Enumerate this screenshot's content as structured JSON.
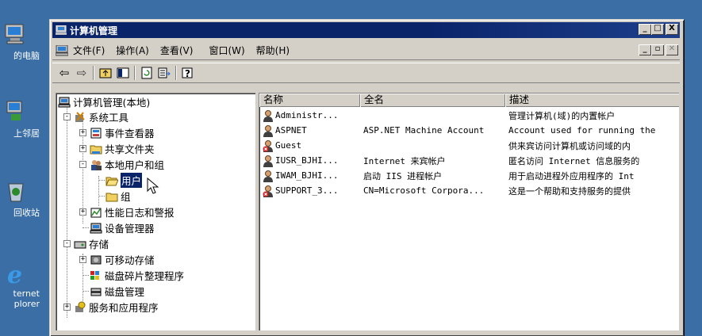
{
  "desktop": {
    "icons": [
      {
        "label": "的电脑",
        "icon": "my-computer-icon"
      },
      {
        "label": "上邻居",
        "icon": "network-places-icon"
      },
      {
        "label": "回收站",
        "icon": "recycle-bin-icon"
      },
      {
        "label": "ternet",
        "label2": "plorer",
        "icon": "internet-explorer-icon"
      }
    ]
  },
  "window": {
    "title": "计算机管理",
    "buttons": {
      "minimize": "_",
      "maximize": "□",
      "close": "X"
    }
  },
  "menubar": {
    "items": [
      "文件(F)",
      "操作(A)",
      "查看(V)",
      "窗口(W)",
      "帮助(H)"
    ],
    "child_buttons": {
      "minimize": "_",
      "restore": "▫",
      "close": "✕"
    }
  },
  "toolbar": {
    "back": "⇦",
    "forward": "⇨"
  },
  "tree": {
    "root": "计算机管理(本地)",
    "system_tools": "系统工具",
    "event_viewer": "事件查看器",
    "shared_folders": "共享文件夹",
    "local_users_groups": "本地用户和组",
    "users": "用户",
    "groups": "组",
    "perf_logs": "性能日志和警报",
    "device_manager": "设备管理器",
    "storage": "存储",
    "removable_storage": "可移动存储",
    "defrag": "磁盘碎片整理程序",
    "disk_mgmt": "磁盘管理",
    "services_apps": "服务和应用程序"
  },
  "list": {
    "headers": [
      "名称",
      "全名",
      "描述"
    ],
    "rows": [
      {
        "name": "Administr...",
        "full_name": "",
        "desc": "管理计算机(域)的内置帐户",
        "disabled": false
      },
      {
        "name": "ASPNET",
        "full_name": "ASP.NET Machine Account",
        "desc": "Account used for running the",
        "disabled": false
      },
      {
        "name": "Guest",
        "full_name": "",
        "desc": "供来宾访问计算机或访问域的内",
        "disabled": true
      },
      {
        "name": "IUSR_BJHI...",
        "full_name": "Internet 来宾帐户",
        "desc": "匿名访问 Internet 信息服务的",
        "disabled": false
      },
      {
        "name": "IWAM_BJHI...",
        "full_name": "启动 IIS 进程帐户",
        "desc": "用于启动进程外应用程序的 Int",
        "disabled": false
      },
      {
        "name": "SUPPORT_3...",
        "full_name": "CN=Microsoft Corpora...",
        "desc": "这是一个帮助和支持服务的提供",
        "disabled": true
      }
    ]
  }
}
